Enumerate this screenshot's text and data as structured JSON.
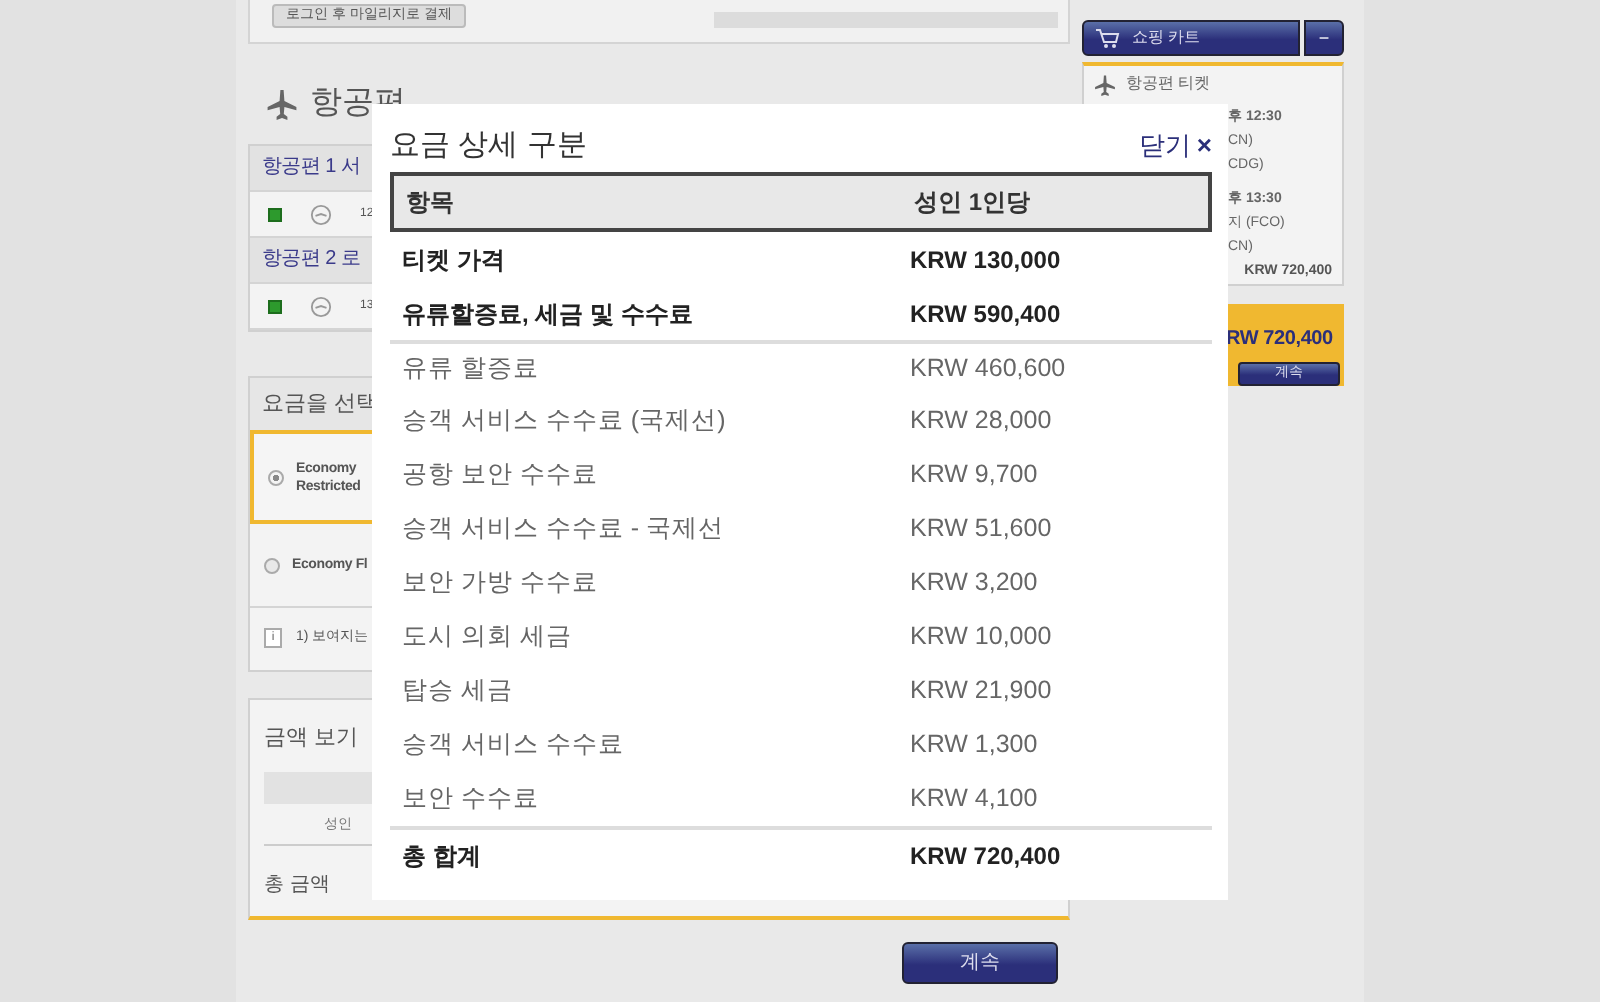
{
  "top_card": {
    "button": "로그인 후 마일리지로 결제"
  },
  "flights": {
    "title": "항공편",
    "segments": [
      {
        "header": "항공편 1 서",
        "checked": true,
        "time": "12"
      },
      {
        "header": "항공편 2 로",
        "checked": true,
        "time": "13"
      }
    ]
  },
  "fares": {
    "title": "요금을 선택",
    "options": [
      {
        "label": "Economy Restricted",
        "selected": true
      },
      {
        "label": "Economy Fl",
        "selected": false
      }
    ],
    "note_icon": "i",
    "note": "1) 보여지는"
  },
  "amount": {
    "title": "금액 보기",
    "passenger": "성인",
    "total_label": "총 금액"
  },
  "continue_button": "계속",
  "cart": {
    "title": "쇼핑 카트",
    "collapse": "−",
    "section": "항공편 티켓",
    "legs": [
      {
        "time": "후 12:30",
        "lines": [
          "CN)",
          "CDG)"
        ]
      },
      {
        "time": "후 13:30",
        "lines": [
          "지 (FCO)",
          "CN)"
        ]
      }
    ],
    "subtotal": "KRW 720,400",
    "total": "RW 720,400",
    "continue": "계속"
  },
  "modal": {
    "title": "요금 상세 구분",
    "close": "닫기",
    "close_icon": "×",
    "columns": [
      "항목",
      "성인 1인당"
    ],
    "rows": [
      {
        "kind": "main",
        "label": "티켓 가격",
        "value": "KRW 130,000"
      },
      {
        "kind": "main",
        "label": "유류할증료, 세금 및 수수료",
        "value": "KRW 590,400"
      },
      {
        "kind": "detail",
        "label": "유류 할증료",
        "value": "KRW 460,600"
      },
      {
        "kind": "detail",
        "label": "승객 서비스 수수료 (국제선)",
        "value": "KRW 28,000"
      },
      {
        "kind": "detail",
        "label": "공항 보안 수수료",
        "value": "KRW 9,700"
      },
      {
        "kind": "detail",
        "label": "승객 서비스 수수료 - 국제선",
        "value": "KRW 51,600"
      },
      {
        "kind": "detail",
        "label": "보안 가방 수수료",
        "value": "KRW 3,200"
      },
      {
        "kind": "detail",
        "label": "도시 의회 세금",
        "value": "KRW 10,000"
      },
      {
        "kind": "detail",
        "label": "탑승 세금",
        "value": "KRW 21,900"
      },
      {
        "kind": "detail",
        "label": "승객 서비스 수수료",
        "value": "KRW 1,300"
      },
      {
        "kind": "detail",
        "label": "보안 수수료",
        "value": "KRW 4,100"
      },
      {
        "kind": "total",
        "label": "총 합계",
        "value": "KRW 720,400"
      }
    ]
  }
}
